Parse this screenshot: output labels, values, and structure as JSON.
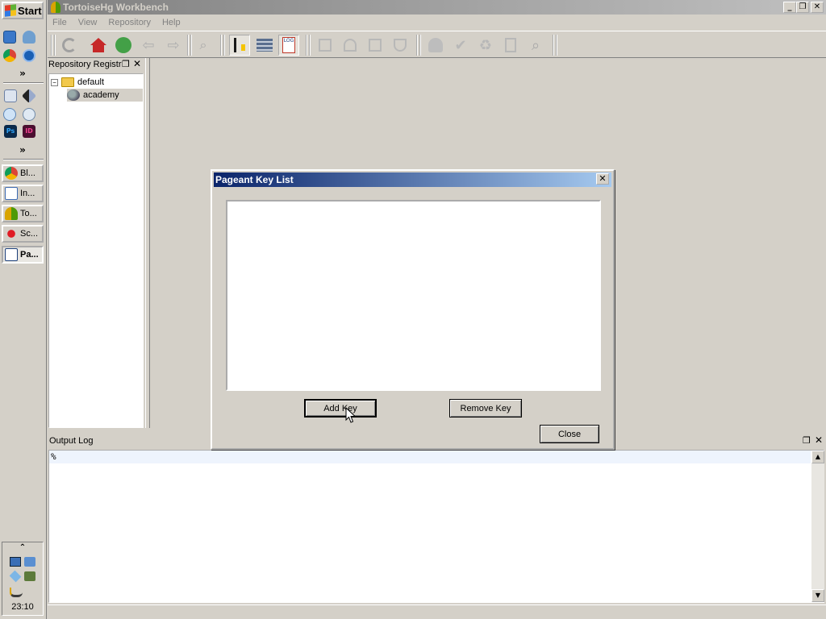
{
  "taskbar": {
    "start_label": "Start",
    "more_label_1": "»",
    "more_label_2": "»",
    "tasks": [
      {
        "label": "Bl...",
        "icon": "chrome-icon"
      },
      {
        "label": "In...",
        "icon": "document-icon"
      },
      {
        "label": "To...",
        "icon": "tortoisehg-icon"
      },
      {
        "label": "Sc...",
        "icon": "screenshot-icon"
      },
      {
        "label": "Pa...",
        "icon": "pageant-icon"
      }
    ],
    "tray_expand": "⌃",
    "clock": "23:10"
  },
  "window": {
    "title": "TortoiseHg Workbench",
    "menu": [
      "File",
      "View",
      "Repository",
      "Help"
    ]
  },
  "repo_registry": {
    "title": "Repository Registr",
    "group": "default",
    "repo": "academy"
  },
  "output_log": {
    "title": "Output Log",
    "prompt": "%"
  },
  "dialog": {
    "title": "Pageant Key List",
    "add_key_label": "Add Key",
    "remove_key_label": "Remove Key",
    "close_label": "Close"
  },
  "colors": {
    "dialog_title_start": "#0a246a",
    "dialog_title_end": "#a6caf0",
    "window_face": "#d4d0c8"
  }
}
